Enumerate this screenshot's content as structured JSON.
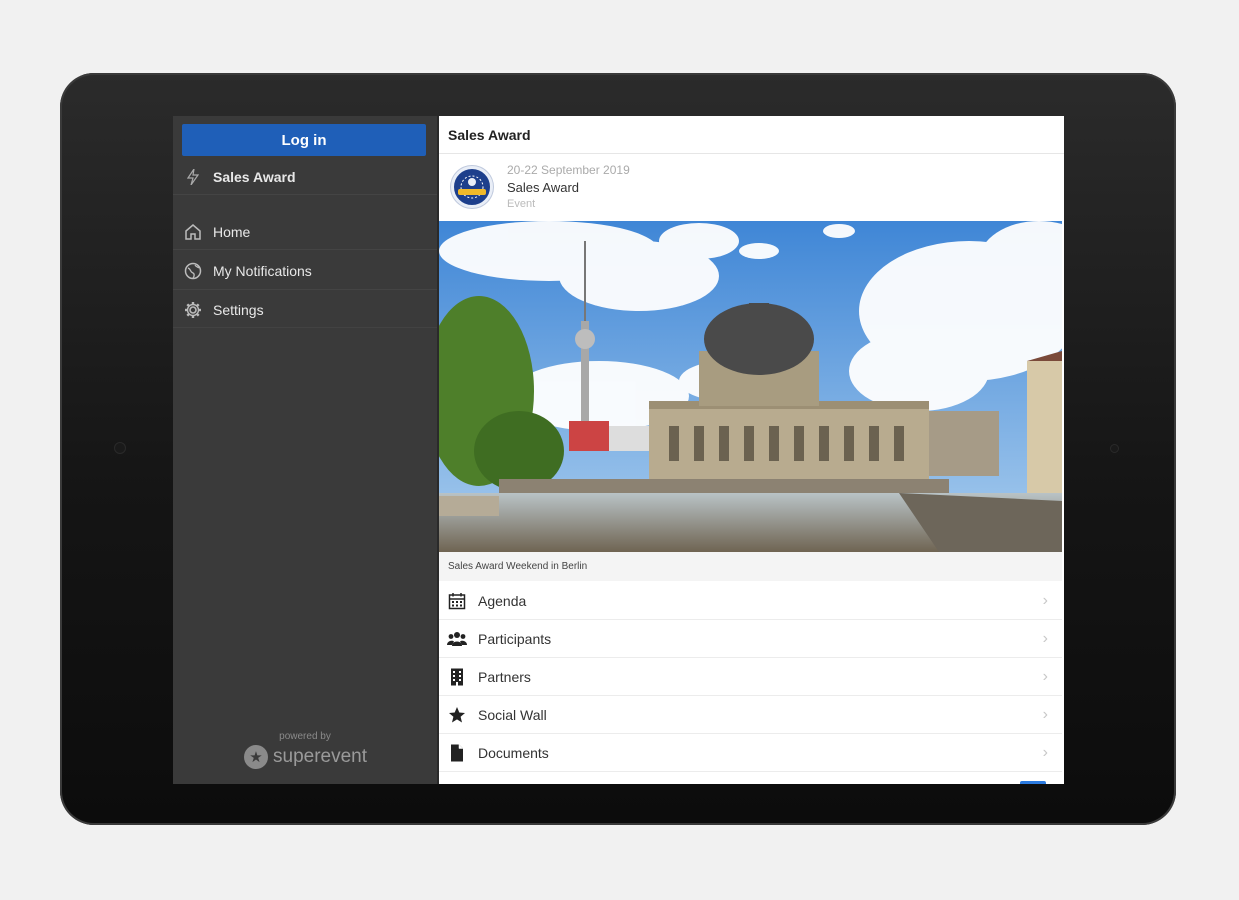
{
  "sidebar": {
    "login_label": "Log in",
    "event_label": "Sales Award",
    "items": [
      {
        "label": "Home",
        "icon": "home-icon"
      },
      {
        "label": "My Notifications",
        "icon": "globe-icon"
      },
      {
        "label": "Settings",
        "icon": "gear-icon"
      }
    ],
    "powered_by": "powered by",
    "brand": "superevent"
  },
  "main": {
    "title": "Sales Award",
    "event": {
      "date": "20-22 September 2019",
      "name": "Sales Award",
      "type": "Event"
    },
    "hero_caption": "Sales Award Weekend in Berlin",
    "menu": [
      {
        "label": "Agenda",
        "icon": "calendar-icon"
      },
      {
        "label": "Participants",
        "icon": "people-icon"
      },
      {
        "label": "Partners",
        "icon": "building-icon"
      },
      {
        "label": "Social Wall",
        "icon": "star-icon"
      },
      {
        "label": "Documents",
        "icon": "document-icon"
      }
    ]
  },
  "colors": {
    "accent": "#1f5fb8",
    "sidebar_bg": "#3a3a3a",
    "device_frame": "#1c1c1c"
  }
}
